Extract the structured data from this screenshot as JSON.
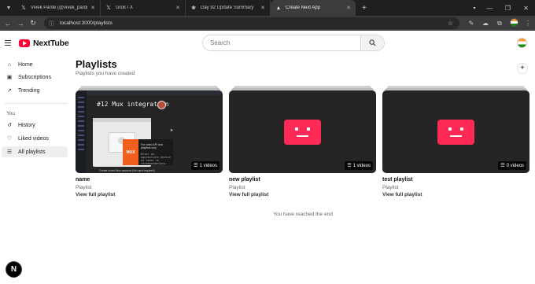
{
  "browser": {
    "tabs": [
      {
        "title": "Vivek Parde (@vivek_parde) / X",
        "favicon": "x-logo",
        "active": false
      },
      {
        "title": "Grok / X",
        "favicon": "x-logo",
        "active": false
      },
      {
        "title": "Day 92 Update Summary",
        "favicon": "openai-logo",
        "active": false
      },
      {
        "title": "Create Next App",
        "favicon": "triangle-logo",
        "active": true
      }
    ],
    "url": "localhost:3000/playlists"
  },
  "app": {
    "logo_text": "NextTube",
    "search_placeholder": "Search"
  },
  "sidebar": {
    "items": [
      {
        "label": "Home",
        "icon": "home-icon"
      },
      {
        "label": "Subscriptions",
        "icon": "subscriptions-icon"
      },
      {
        "label": "Trending",
        "icon": "trending-icon"
      }
    ],
    "you_heading": "You",
    "you_items": [
      {
        "label": "History",
        "icon": "history-icon"
      },
      {
        "label": "Liked videos",
        "icon": "thumbs-up-icon"
      },
      {
        "label": "All playlists",
        "icon": "playlist-icon",
        "active": true
      }
    ]
  },
  "main": {
    "title": "Playlists",
    "subtitle": "Playlists you have created",
    "add_symbol": "+",
    "playlists": [
      {
        "name": "name",
        "type": "Playlist",
        "link": "View full playlist",
        "count": "1 videos",
        "thumbnail": "video"
      },
      {
        "name": "new playlist",
        "type": "Playlist",
        "link": "View full playlist",
        "count": "1 videos",
        "thumbnail": "error"
      },
      {
        "name": "test playlist",
        "type": "Playlist",
        "link": "View full playlist",
        "count": "0 videos",
        "thumbnail": "error"
      }
    ],
    "end_message": "You have reached the end"
  },
  "thumbnail_text": {
    "heading": "#12 Mux integration",
    "brand": "MUX",
    "mux_caption": "For video API and playlists only",
    "mux_sub": "Enter an appropriate device at least in recommendations",
    "note": "Create a free Mux account (No card required)"
  },
  "devtools": {
    "bubble_letter": "N"
  },
  "colors": {
    "accent_red": "#ff0033",
    "error_pink": "#ff2a55",
    "chrome_dark": "#1f1f1f"
  }
}
